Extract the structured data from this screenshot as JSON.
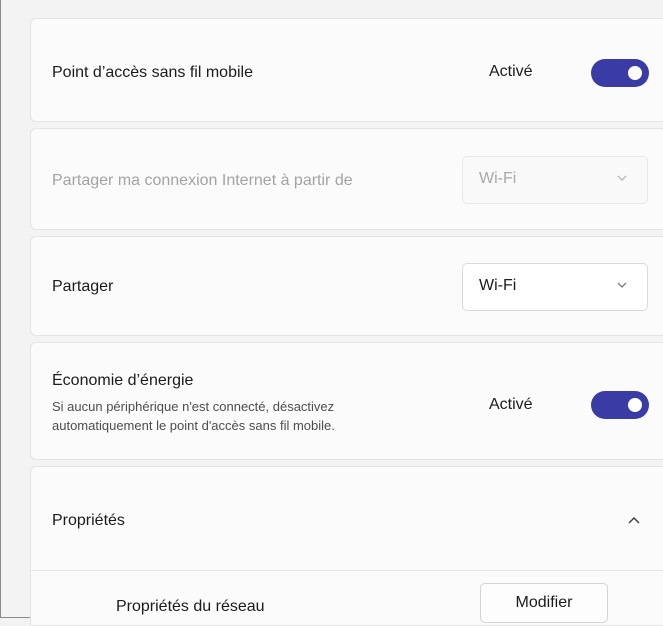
{
  "hotspot": {
    "label": "Point d’accès sans fil mobile",
    "status": "Activé",
    "toggle_on": true
  },
  "share_from": {
    "label": "Partager ma connexion Internet à partir de",
    "value": "Wi-Fi",
    "disabled": true
  },
  "share_over": {
    "label": "Partager",
    "value": "Wi-Fi"
  },
  "power_saving": {
    "title": "Économie d’énergie",
    "description_line1": "Si aucun périphérique n'est connecté, désactivez",
    "description_line2": "automatiquement le point d'accès sans fil mobile.",
    "status": "Activé",
    "toggle_on": true
  },
  "properties": {
    "title": "Propriétés",
    "expanded": true,
    "network_label": "Propriétés du réseau",
    "edit_button": "Modifier"
  },
  "icons": {
    "dropdown": "chevron-down-icon",
    "collapse": "chevron-up-icon"
  },
  "colors": {
    "accent": "#3b3ba6",
    "card": "#fbfbfb",
    "background": "#f3f3f3",
    "disabled_text": "#a3a3a3"
  }
}
